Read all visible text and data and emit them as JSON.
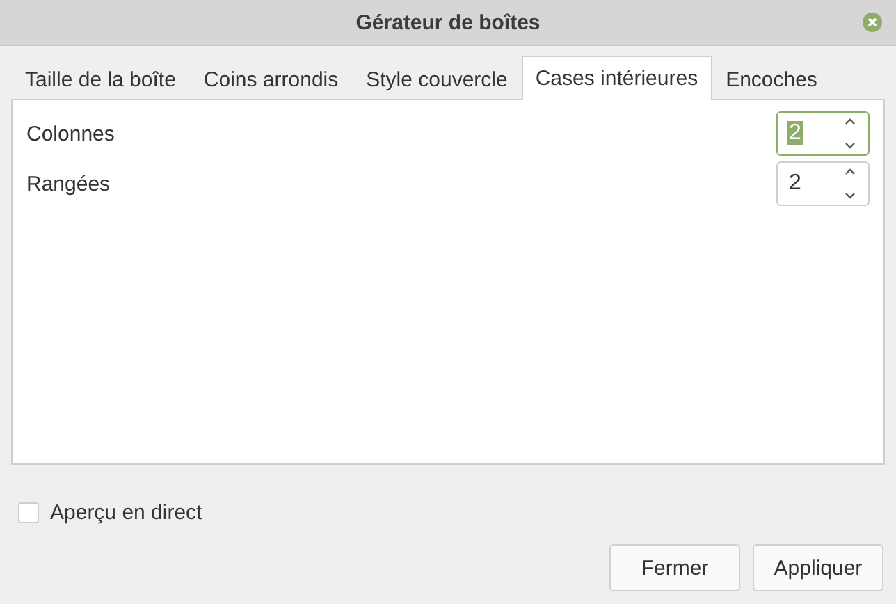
{
  "window": {
    "title": "Gérateur de boîtes"
  },
  "tabs": [
    {
      "label": "Taille de la boîte",
      "selected": false
    },
    {
      "label": "Coins arrondis",
      "selected": false
    },
    {
      "label": "Style couvercle",
      "selected": false
    },
    {
      "label": "Cases intérieures",
      "selected": true
    },
    {
      "label": "Encoches",
      "selected": false
    }
  ],
  "fields": [
    {
      "label": "Colonnes",
      "value": "2",
      "focused": true
    },
    {
      "label": "Rangées",
      "value": "2",
      "focused": false
    }
  ],
  "live_preview": {
    "label": "Aperçu en direct",
    "checked": false
  },
  "buttons": [
    "Fermer",
    "Appliquer"
  ]
}
